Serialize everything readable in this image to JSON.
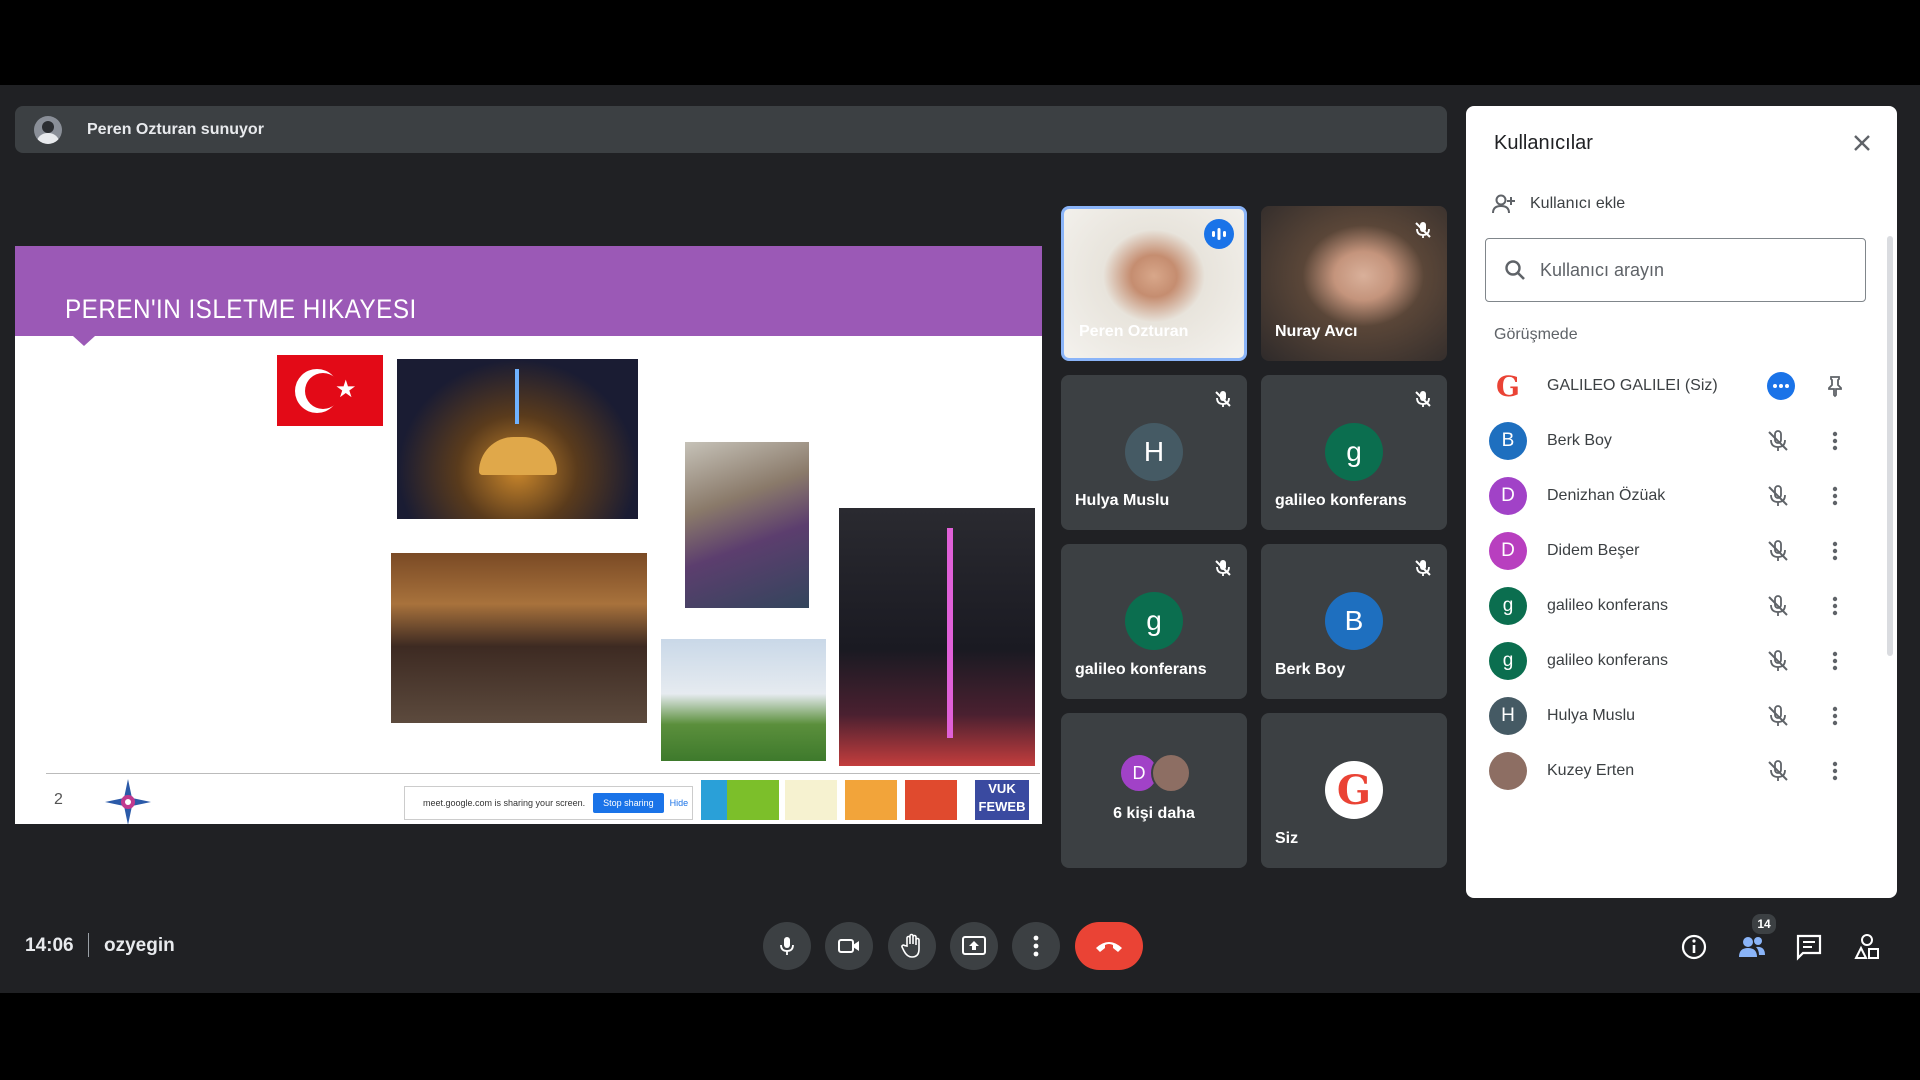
{
  "presenter": {
    "label": "Peren Ozturan sunuyor"
  },
  "slide": {
    "title": "PEREN'IN ISLETME HIKAYESI",
    "page_number": "2",
    "share_banner": {
      "text": "meet.google.com is sharing your screen.",
      "stop": "Stop sharing",
      "hide": "Hide"
    },
    "logo_text": "VUK FEWEB"
  },
  "tiles": [
    {
      "name": "Peren Ozturan",
      "avatar": ""
    },
    {
      "name": "Nuray Avcı",
      "avatar": ""
    },
    {
      "name": "Hulya Muslu",
      "avatar": "H"
    },
    {
      "name": "galileo konferans",
      "avatar": "g"
    },
    {
      "name": "galileo konferans",
      "avatar": "g"
    },
    {
      "name": "Berk Boy",
      "avatar": "B"
    },
    {
      "name": "6 kişi daha",
      "avatar": "D"
    },
    {
      "name": "Siz",
      "avatar": "G"
    }
  ],
  "panel": {
    "title": "Kullanıcılar",
    "add_user": "Kullanıcı ekle",
    "search_placeholder": "Kullanıcı arayın",
    "section": "Görüşmede",
    "people": [
      {
        "name": "GALILEO GALILEI (Siz)",
        "initial": "G",
        "color": "#ffffff"
      },
      {
        "name": "Berk Boy",
        "initial": "B",
        "color": "#1e6fbf"
      },
      {
        "name": "Denizhan Özüak",
        "initial": "D",
        "color": "#a142c7"
      },
      {
        "name": "Didem Beşer",
        "initial": "D",
        "color": "#b83fbf"
      },
      {
        "name": "galileo konferans",
        "initial": "g",
        "color": "#0b6e4f"
      },
      {
        "name": "galileo konferans",
        "initial": "g",
        "color": "#0b6e4f"
      },
      {
        "name": "Hulya Muslu",
        "initial": "H",
        "color": "#455a64"
      },
      {
        "name": "Kuzey Erten",
        "initial": "",
        "color": "#8d6e63"
      }
    ]
  },
  "bottom": {
    "time": "14:06",
    "meeting_code": "ozyegin",
    "participants_count": "14"
  },
  "colors": {
    "accent": "#1a73e8",
    "end_call": "#ea4335",
    "slide_header": "#9b59b6"
  }
}
